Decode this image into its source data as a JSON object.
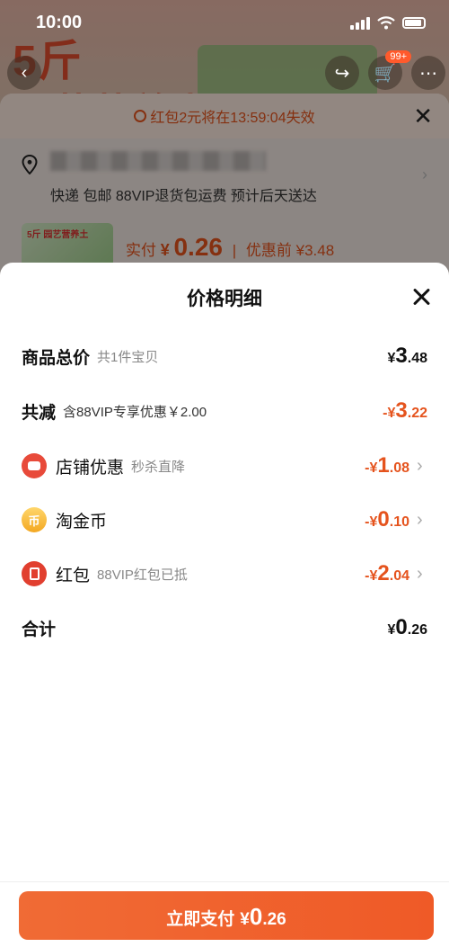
{
  "status": {
    "time": "10:00"
  },
  "background": {
    "hero_title": "5斤",
    "hero_sub": "园艺营养土",
    "cart_badge": "99+",
    "notice": "红包2元将在13:59:04失效",
    "shipping": "快递 包邮 88VIP退货包运费 预计后天送达",
    "thumb_text": "5斤 园艺营养土",
    "paid_label": "实付",
    "paid_yen": "¥",
    "paid_amount": "0.26",
    "before_label": "优惠前",
    "before_amount": "¥3.48"
  },
  "modal": {
    "title": "价格明细",
    "rows": {
      "total": {
        "label": "商品总价",
        "sub": "共1件宝贝",
        "sign": "¥",
        "int": "3",
        "dec": ".48"
      },
      "reduce": {
        "label": "共减",
        "sub": "含88VIP专享优惠￥2.00",
        "sign": "-¥",
        "int": "3",
        "dec": ".22"
      },
      "shop": {
        "label": "店铺优惠",
        "sub": "秒杀直降",
        "sign": "-¥",
        "int": "1",
        "dec": ".08"
      },
      "coin": {
        "label": "淘金币",
        "sub": "",
        "sign": "-¥",
        "int": "0",
        "dec": ".10"
      },
      "redpack": {
        "label": "红包",
        "sub": "88VIP红包已抵",
        "sign": "-¥",
        "int": "2",
        "dec": ".04"
      },
      "sum": {
        "label": "合计",
        "sign": "¥",
        "int": "0",
        "dec": ".26"
      }
    },
    "coin_glyph": "币"
  },
  "pay_button": {
    "label": "立即支付",
    "yen": "¥",
    "int": "0",
    "dec": ".26"
  },
  "colors": {
    "accent": "#e5531d",
    "button": "#ef5a27"
  }
}
